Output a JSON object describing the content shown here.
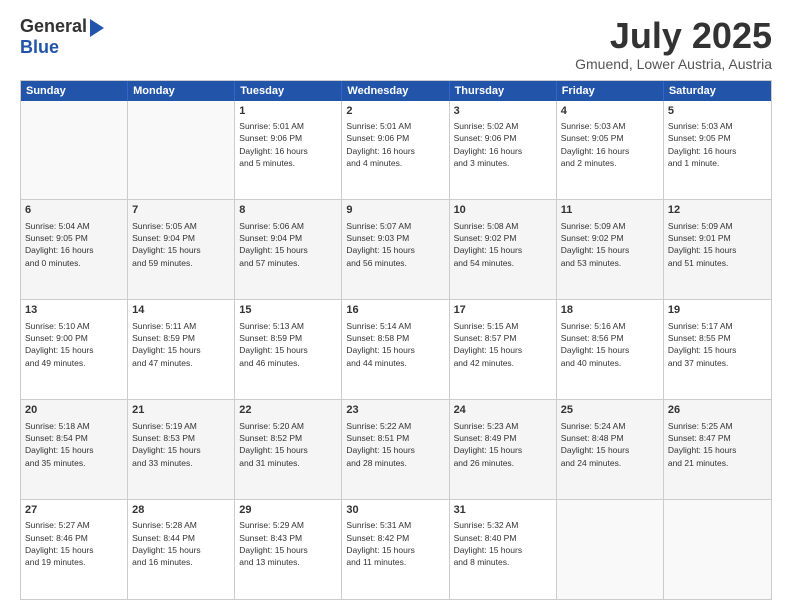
{
  "logo": {
    "line1": "General",
    "line2": "Blue",
    "arrow": "▶"
  },
  "title": {
    "month_year": "July 2025",
    "location": "Gmuend, Lower Austria, Austria"
  },
  "days_of_week": [
    "Sunday",
    "Monday",
    "Tuesday",
    "Wednesday",
    "Thursday",
    "Friday",
    "Saturday"
  ],
  "rows": [
    [
      {
        "day": "",
        "empty": true
      },
      {
        "day": "",
        "empty": true
      },
      {
        "day": "1",
        "info": "Sunrise: 5:01 AM\nSunset: 9:06 PM\nDaylight: 16 hours\nand 5 minutes."
      },
      {
        "day": "2",
        "info": "Sunrise: 5:01 AM\nSunset: 9:06 PM\nDaylight: 16 hours\nand 4 minutes."
      },
      {
        "day": "3",
        "info": "Sunrise: 5:02 AM\nSunset: 9:06 PM\nDaylight: 16 hours\nand 3 minutes."
      },
      {
        "day": "4",
        "info": "Sunrise: 5:03 AM\nSunset: 9:05 PM\nDaylight: 16 hours\nand 2 minutes."
      },
      {
        "day": "5",
        "info": "Sunrise: 5:03 AM\nSunset: 9:05 PM\nDaylight: 16 hours\nand 1 minute."
      }
    ],
    [
      {
        "day": "6",
        "info": "Sunrise: 5:04 AM\nSunset: 9:05 PM\nDaylight: 16 hours\nand 0 minutes."
      },
      {
        "day": "7",
        "info": "Sunrise: 5:05 AM\nSunset: 9:04 PM\nDaylight: 15 hours\nand 59 minutes."
      },
      {
        "day": "8",
        "info": "Sunrise: 5:06 AM\nSunset: 9:04 PM\nDaylight: 15 hours\nand 57 minutes."
      },
      {
        "day": "9",
        "info": "Sunrise: 5:07 AM\nSunset: 9:03 PM\nDaylight: 15 hours\nand 56 minutes."
      },
      {
        "day": "10",
        "info": "Sunrise: 5:08 AM\nSunset: 9:02 PM\nDaylight: 15 hours\nand 54 minutes."
      },
      {
        "day": "11",
        "info": "Sunrise: 5:09 AM\nSunset: 9:02 PM\nDaylight: 15 hours\nand 53 minutes."
      },
      {
        "day": "12",
        "info": "Sunrise: 5:09 AM\nSunset: 9:01 PM\nDaylight: 15 hours\nand 51 minutes."
      }
    ],
    [
      {
        "day": "13",
        "info": "Sunrise: 5:10 AM\nSunset: 9:00 PM\nDaylight: 15 hours\nand 49 minutes."
      },
      {
        "day": "14",
        "info": "Sunrise: 5:11 AM\nSunset: 8:59 PM\nDaylight: 15 hours\nand 47 minutes."
      },
      {
        "day": "15",
        "info": "Sunrise: 5:13 AM\nSunset: 8:59 PM\nDaylight: 15 hours\nand 46 minutes."
      },
      {
        "day": "16",
        "info": "Sunrise: 5:14 AM\nSunset: 8:58 PM\nDaylight: 15 hours\nand 44 minutes."
      },
      {
        "day": "17",
        "info": "Sunrise: 5:15 AM\nSunset: 8:57 PM\nDaylight: 15 hours\nand 42 minutes."
      },
      {
        "day": "18",
        "info": "Sunrise: 5:16 AM\nSunset: 8:56 PM\nDaylight: 15 hours\nand 40 minutes."
      },
      {
        "day": "19",
        "info": "Sunrise: 5:17 AM\nSunset: 8:55 PM\nDaylight: 15 hours\nand 37 minutes."
      }
    ],
    [
      {
        "day": "20",
        "info": "Sunrise: 5:18 AM\nSunset: 8:54 PM\nDaylight: 15 hours\nand 35 minutes."
      },
      {
        "day": "21",
        "info": "Sunrise: 5:19 AM\nSunset: 8:53 PM\nDaylight: 15 hours\nand 33 minutes."
      },
      {
        "day": "22",
        "info": "Sunrise: 5:20 AM\nSunset: 8:52 PM\nDaylight: 15 hours\nand 31 minutes."
      },
      {
        "day": "23",
        "info": "Sunrise: 5:22 AM\nSunset: 8:51 PM\nDaylight: 15 hours\nand 28 minutes."
      },
      {
        "day": "24",
        "info": "Sunrise: 5:23 AM\nSunset: 8:49 PM\nDaylight: 15 hours\nand 26 minutes."
      },
      {
        "day": "25",
        "info": "Sunrise: 5:24 AM\nSunset: 8:48 PM\nDaylight: 15 hours\nand 24 minutes."
      },
      {
        "day": "26",
        "info": "Sunrise: 5:25 AM\nSunset: 8:47 PM\nDaylight: 15 hours\nand 21 minutes."
      }
    ],
    [
      {
        "day": "27",
        "info": "Sunrise: 5:27 AM\nSunset: 8:46 PM\nDaylight: 15 hours\nand 19 minutes."
      },
      {
        "day": "28",
        "info": "Sunrise: 5:28 AM\nSunset: 8:44 PM\nDaylight: 15 hours\nand 16 minutes."
      },
      {
        "day": "29",
        "info": "Sunrise: 5:29 AM\nSunset: 8:43 PM\nDaylight: 15 hours\nand 13 minutes."
      },
      {
        "day": "30",
        "info": "Sunrise: 5:31 AM\nSunset: 8:42 PM\nDaylight: 15 hours\nand 11 minutes."
      },
      {
        "day": "31",
        "info": "Sunrise: 5:32 AM\nSunset: 8:40 PM\nDaylight: 15 hours\nand 8 minutes."
      },
      {
        "day": "",
        "empty": true
      },
      {
        "day": "",
        "empty": true
      }
    ]
  ]
}
